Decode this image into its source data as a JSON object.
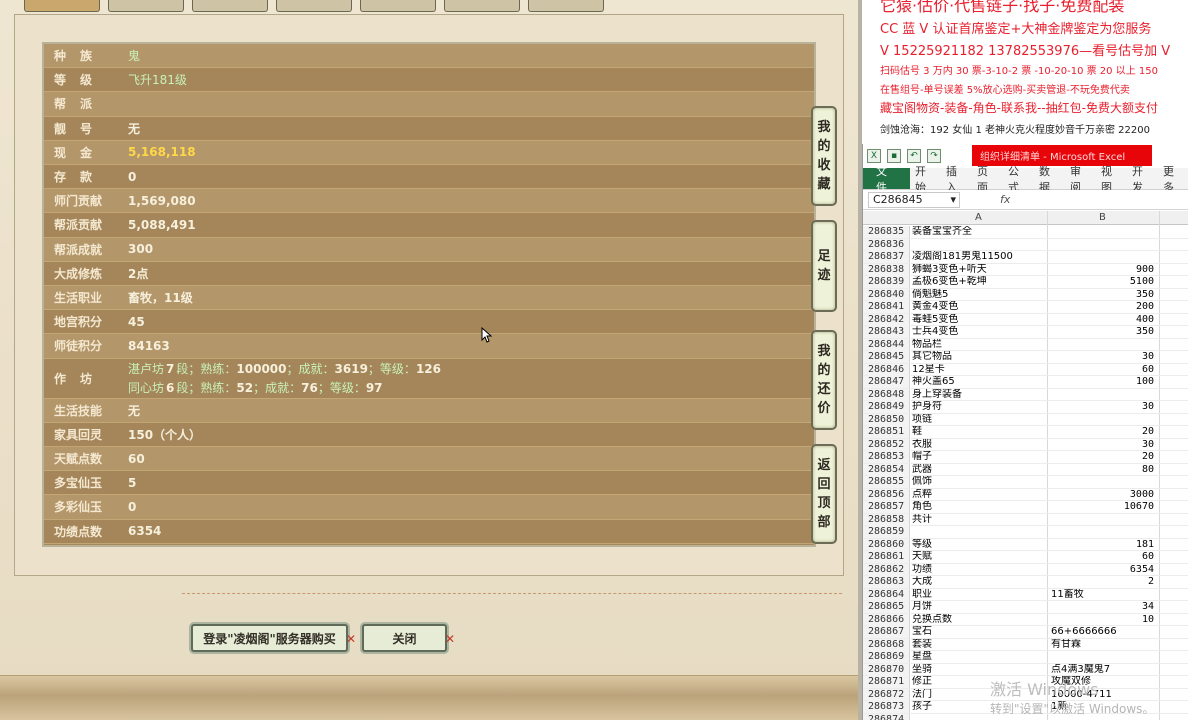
{
  "game": {
    "stats": [
      {
        "label": "种族",
        "value": "鬼",
        "style": "green",
        "spaced": true
      },
      {
        "label": "等级",
        "value": "飞升181级",
        "style": "green",
        "spaced": true
      },
      {
        "label": "帮派",
        "value": "",
        "style": "",
        "spaced": true
      },
      {
        "label": "靓号",
        "value": "无",
        "style": "",
        "spaced": true
      },
      {
        "label": "现金",
        "value": "5,168,118",
        "style": "gold",
        "spaced": true
      },
      {
        "label": "存款",
        "value": "0",
        "style": "",
        "spaced": true
      },
      {
        "label": "师门贡献",
        "value": "1,569,080",
        "style": ""
      },
      {
        "label": "帮派贡献",
        "value": "5,088,491",
        "style": ""
      },
      {
        "label": "帮派成就",
        "value": "300",
        "style": ""
      },
      {
        "label": "大成修炼",
        "value": "2点",
        "style": ""
      },
      {
        "label": "生活职业",
        "value": "畜牧，11级",
        "style": ""
      },
      {
        "label": "地宫积分",
        "value": "45",
        "style": ""
      },
      {
        "label": "师徒积分",
        "value": "84163",
        "style": ""
      }
    ],
    "zuofang": {
      "label": "作坊",
      "line1": {
        "name": "湛卢坊",
        "level": "7",
        "p1": "段；熟练：",
        "exp": "100000",
        "p2": "；成就：",
        "ach": "3619",
        "p3": "；等级：",
        "lvl": "126"
      },
      "line2": {
        "name": "同心坊",
        "level": "6",
        "p1": "段；熟练：",
        "exp": "52",
        "p2": "；成就：",
        "ach": "76",
        "p3": "；等级：",
        "lvl": "97"
      }
    },
    "stats2": [
      {
        "label": "生活技能",
        "value": "无"
      },
      {
        "label": "家具回灵",
        "value": "150（个人）"
      },
      {
        "label": "天赋点数",
        "value": "60"
      },
      {
        "label": "多宝仙玉",
        "value": "5"
      },
      {
        "label": "多彩仙玉",
        "value": "0"
      },
      {
        "label": "功绩点数",
        "value": "6354"
      }
    ],
    "side_buttons": [
      {
        "name": "my-favorites-button",
        "chars": [
          "我",
          "的",
          "收",
          "藏"
        ]
      },
      {
        "name": "footprint-button",
        "chars": [
          "足",
          "迹"
        ]
      },
      {
        "name": "my-offer-button",
        "chars": [
          "我",
          "的",
          "还",
          "价"
        ]
      },
      {
        "name": "back-to-top-button",
        "chars": [
          "返",
          "回",
          "顶",
          "部"
        ]
      }
    ],
    "buy_button": "登录\"凌烟阁\"服务器购买",
    "close_button": "关闭"
  },
  "ad": {
    "top": "它猿·估价·代售链子·找子·免费配装",
    "l1": "CC 蓝 V 认证首席鉴定+大神金牌鉴定为您服务",
    "l2": "V 15225921182    13782553976—看号估号加 V",
    "l3": "扫码估号 3 万内 30 票-3-10-2 票 -10-20-10 票 20 以上 150",
    "l4": "在售组号-单号误差 5%放心选购-买卖管退-不玩免费代卖",
    "l5": "藏宝阁物资-装备-角色-联系我--抽红包-免费大额支付",
    "l6": "剑蚀沧海：192 女仙 1 老神火克火程度妙音千万亲密 22200"
  },
  "excel": {
    "title": "组织详细清单 - Microsoft Excel",
    "tabs": [
      "文件",
      "开始",
      "插入",
      "页面",
      "公式",
      "数据",
      "审阅",
      "视图",
      "开发",
      "更多"
    ],
    "namebox": "C286845",
    "fx": "fx",
    "col_a": "A",
    "col_b": "B",
    "rows": [
      [
        "286835",
        "装备宝宝齐全",
        "",
        "n"
      ],
      [
        "286836",
        "",
        "",
        "n"
      ],
      [
        "286837",
        "凌烟阁181男鬼11500",
        "",
        "n"
      ],
      [
        "286838",
        "狮蝎3变色+听天",
        "900",
        "n"
      ],
      [
        "286839",
        "孟极6变色+乾坤",
        "5100",
        "n"
      ],
      [
        "286840",
        "倘魁魅5",
        "350",
        "n"
      ],
      [
        "286841",
        "黄金4变色",
        "200",
        "n"
      ],
      [
        "286842",
        "毒蛙5变色",
        "400",
        "n"
      ],
      [
        "286843",
        "士兵4变色",
        "350",
        "n"
      ],
      [
        "286844",
        "物品栏",
        "",
        "n"
      ],
      [
        "286845",
        "其它物品",
        "30",
        "n"
      ],
      [
        "286846",
        "12星卡",
        "60",
        "n"
      ],
      [
        "286847",
        "神火盖65",
        "100",
        "n"
      ],
      [
        "286848",
        "身上穿装备",
        "",
        "n"
      ],
      [
        "286849",
        "护身符",
        "30",
        "n"
      ],
      [
        "286850",
        "项链",
        "",
        "n"
      ],
      [
        "286851",
        "鞋",
        "20",
        "n"
      ],
      [
        "286852",
        "衣服",
        "30",
        "n"
      ],
      [
        "286853",
        "帽子",
        "20",
        "n"
      ],
      [
        "286854",
        "武器",
        "80",
        "n"
      ],
      [
        "286855",
        "佩饰",
        "",
        "n"
      ],
      [
        "286856",
        "点粹",
        "3000",
        "n"
      ],
      [
        "286857",
        "角色",
        "10670",
        "n"
      ],
      [
        "286858",
        "共计",
        "",
        "n"
      ],
      [
        "286859",
        "",
        "",
        "n"
      ],
      [
        "286860",
        "等级",
        "181",
        "n"
      ],
      [
        "286861",
        "天赋",
        "60",
        "n"
      ],
      [
        "286862",
        "功绩",
        "6354",
        "n"
      ],
      [
        "286863",
        "大成",
        "2",
        "n"
      ],
      [
        "286864",
        "职业",
        "11畜牧",
        "t"
      ],
      [
        "286865",
        "月饼",
        "34",
        "n"
      ],
      [
        "286866",
        "兑换点数",
        "10",
        "n"
      ],
      [
        "286867",
        "宝石",
        "66+6666666",
        "t"
      ],
      [
        "286868",
        "套装",
        "有甘霖",
        "t"
      ],
      [
        "286869",
        "星盘",
        "",
        "n"
      ],
      [
        "286870",
        "坐骑",
        "点4满3魔鬼7",
        "t"
      ],
      [
        "286871",
        "修正",
        "攻魔双修",
        "t"
      ],
      [
        "286872",
        "法门",
        "10000-4711",
        "t"
      ],
      [
        "286873",
        "孩子",
        "1新",
        "t"
      ],
      [
        "286874",
        "",
        "",
        "n"
      ]
    ]
  },
  "watermark": {
    "line1": "激活 Windows",
    "line2": "转到\"设置\"以激活 Windows。"
  }
}
